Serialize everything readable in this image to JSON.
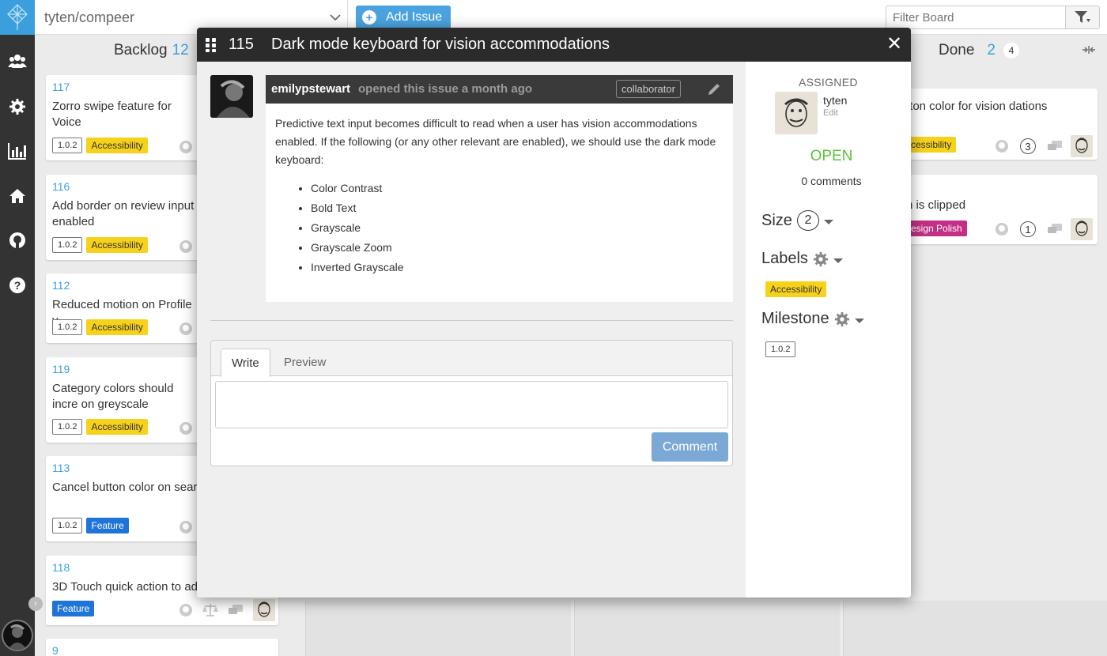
{
  "topbar": {
    "repo": "tyten/compeer",
    "add_issue_label": "Add Issue",
    "filter_placeholder": "Filter Board"
  },
  "columns": {
    "backlog": {
      "title": "Backlog",
      "count": "12"
    },
    "done": {
      "title": "Done",
      "count": "2",
      "badge": "4"
    }
  },
  "backlog_cards": [
    {
      "number": "117",
      "title": "Zorro swipe feature for Voice",
      "milestone": "1.0.2",
      "label": "Accessibility"
    },
    {
      "number": "116",
      "title": "Add border on review input enabled",
      "milestone": "1.0.2",
      "label": "Accessibility"
    },
    {
      "number": "112",
      "title": "Reduced motion on Profile v",
      "milestone": "1.0.2",
      "label": "Accessibility"
    },
    {
      "number": "119",
      "title": "Category colors should incre on greyscale",
      "milestone": "1.0.2",
      "label": "Accessibility"
    },
    {
      "number": "113",
      "title": "Cancel button color on sear",
      "milestone": "1.0.2",
      "label": "Feature"
    },
    {
      "number": "118",
      "title": "3D Touch quick action to ad",
      "label": "Feature"
    },
    {
      "number": "9"
    }
  ],
  "done_cards": [
    {
      "title": "tton color for vision dations",
      "label": "cessibility",
      "comments": "3"
    },
    {
      "title": "n is clipped",
      "label": "esign Polish",
      "comments": "1"
    }
  ],
  "modal": {
    "number": "115",
    "title": "Dark mode keyboard for vision accommodations",
    "author": "emilypstewart",
    "meta": "opened this issue a month ago",
    "role_badge": "collaborator",
    "body": "Predictive text input becomes difficult to read when a user has vision accommodations enabled. If the following (or any other relevant are enabled), we should use the dark mode keyboard:",
    "list": [
      "Color Contrast",
      "Bold Text",
      "Grayscale",
      "Grayscale Zoom",
      "Inverted Grayscale"
    ],
    "tabs": {
      "write": "Write",
      "preview": "Preview"
    },
    "comment_button": "Comment",
    "sidebar": {
      "assigned_heading": "ASSIGNED",
      "assignee": "tyten",
      "assignee_edit": "Edit",
      "state": "OPEN",
      "comments_count": "0",
      "comments_word": "comments",
      "size_heading": "Size",
      "size_value": "2",
      "labels_heading": "Labels",
      "label": "Accessibility",
      "milestone_heading": "Milestone",
      "milestone": "1.0.2"
    }
  },
  "colors": {
    "accent": "#3b9fde",
    "accessibility": "#f7d21b",
    "feature": "#1f74d8",
    "design_polish": "#c22f84",
    "open": "#5cc13a"
  }
}
